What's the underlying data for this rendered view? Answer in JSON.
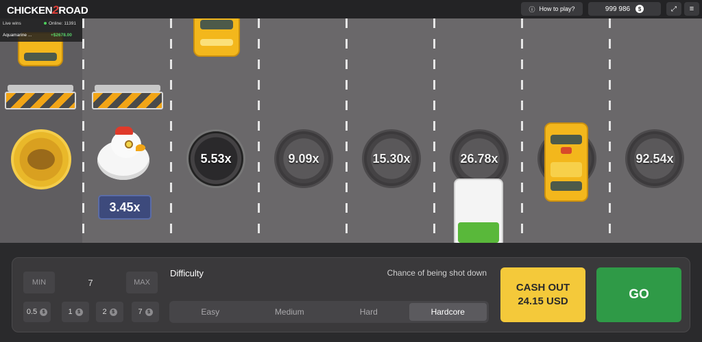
{
  "header": {
    "logo_left": "CHICKEN",
    "logo_mid": "2",
    "logo_right": "ROAD",
    "how_to_play": "How to play?",
    "balance": "999 986",
    "currency_symbol": "$",
    "fullscreen_glyph": "⤢",
    "menu_glyph": "≡"
  },
  "live": {
    "label": "Live wins",
    "online": "Online: 11391",
    "user": "Aquamarine ...",
    "amount": "+$2678.00"
  },
  "lanes": {
    "multipliers": [
      "5.53x",
      "9.09x",
      "15.30x",
      "26.78x",
      "",
      "92.54x"
    ],
    "current_multiplier": "3.45x"
  },
  "controls": {
    "min_label": "MIN",
    "max_label": "MAX",
    "bet_value": "7",
    "quick_bets": [
      "0.5",
      "1",
      "2",
      "7"
    ],
    "difficulty_label": "Difficulty",
    "chance_label": "Chance of being shot down",
    "difficulties": [
      "Easy",
      "Medium",
      "Hard",
      "Hardcore"
    ],
    "selected_difficulty": "Hardcore",
    "cashout_line1": "CASH OUT",
    "cashout_line2": "24.15 USD",
    "go_label": "GO"
  }
}
